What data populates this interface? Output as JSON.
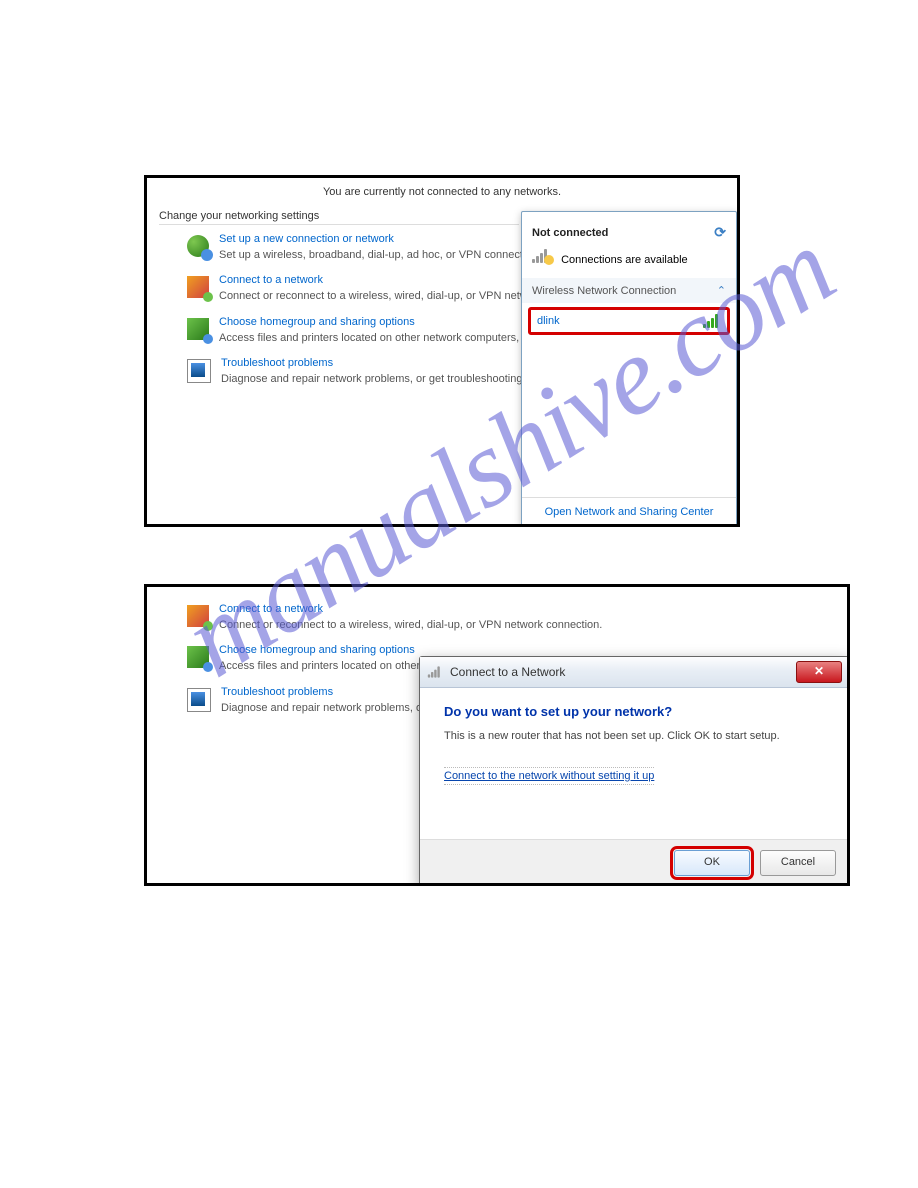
{
  "watermark": "manualshive.com",
  "shot1": {
    "header_msg": "You are currently not connected to any networks.",
    "section_title": "Change your networking settings",
    "items": [
      {
        "link": "Set up a new connection or network",
        "desc": "Set up a wireless, broadband, dial-up, ad hoc, or VPN connection; or set up a router or access point."
      },
      {
        "link": "Connect to a network",
        "desc": "Connect or reconnect to a wireless, wired, dial-up, or VPN network connection."
      },
      {
        "link": "Choose homegroup and sharing options",
        "desc": "Access files and printers located on other network computers, or change sharing settings."
      },
      {
        "link": "Troubleshoot problems",
        "desc": "Diagnose and repair network problems, or get troubleshooting information."
      }
    ],
    "flyout": {
      "status": "Not connected",
      "avail": "Connections are available",
      "category": "Wireless Network Connection",
      "network": "dlink",
      "footer": "Open Network and Sharing Center"
    }
  },
  "shot2": {
    "items": [
      {
        "link": "Connect to a network",
        "desc": "Connect or reconnect to a wireless, wired, dial-up, or VPN network connection."
      },
      {
        "link": "Choose homegroup and sharing options",
        "desc": "Access files and printers located on other network computers, or change sharing settings."
      },
      {
        "link": "Troubleshoot problems",
        "desc": "Diagnose and repair network problems, or get troubleshooting information."
      }
    ],
    "dialog": {
      "title": "Connect to a Network",
      "heading": "Do you want to set up your network?",
      "text": "This is a new router that has not been set up. Click OK to start setup.",
      "link": "Connect to the network without setting it up",
      "ok": "OK",
      "cancel": "Cancel"
    }
  }
}
